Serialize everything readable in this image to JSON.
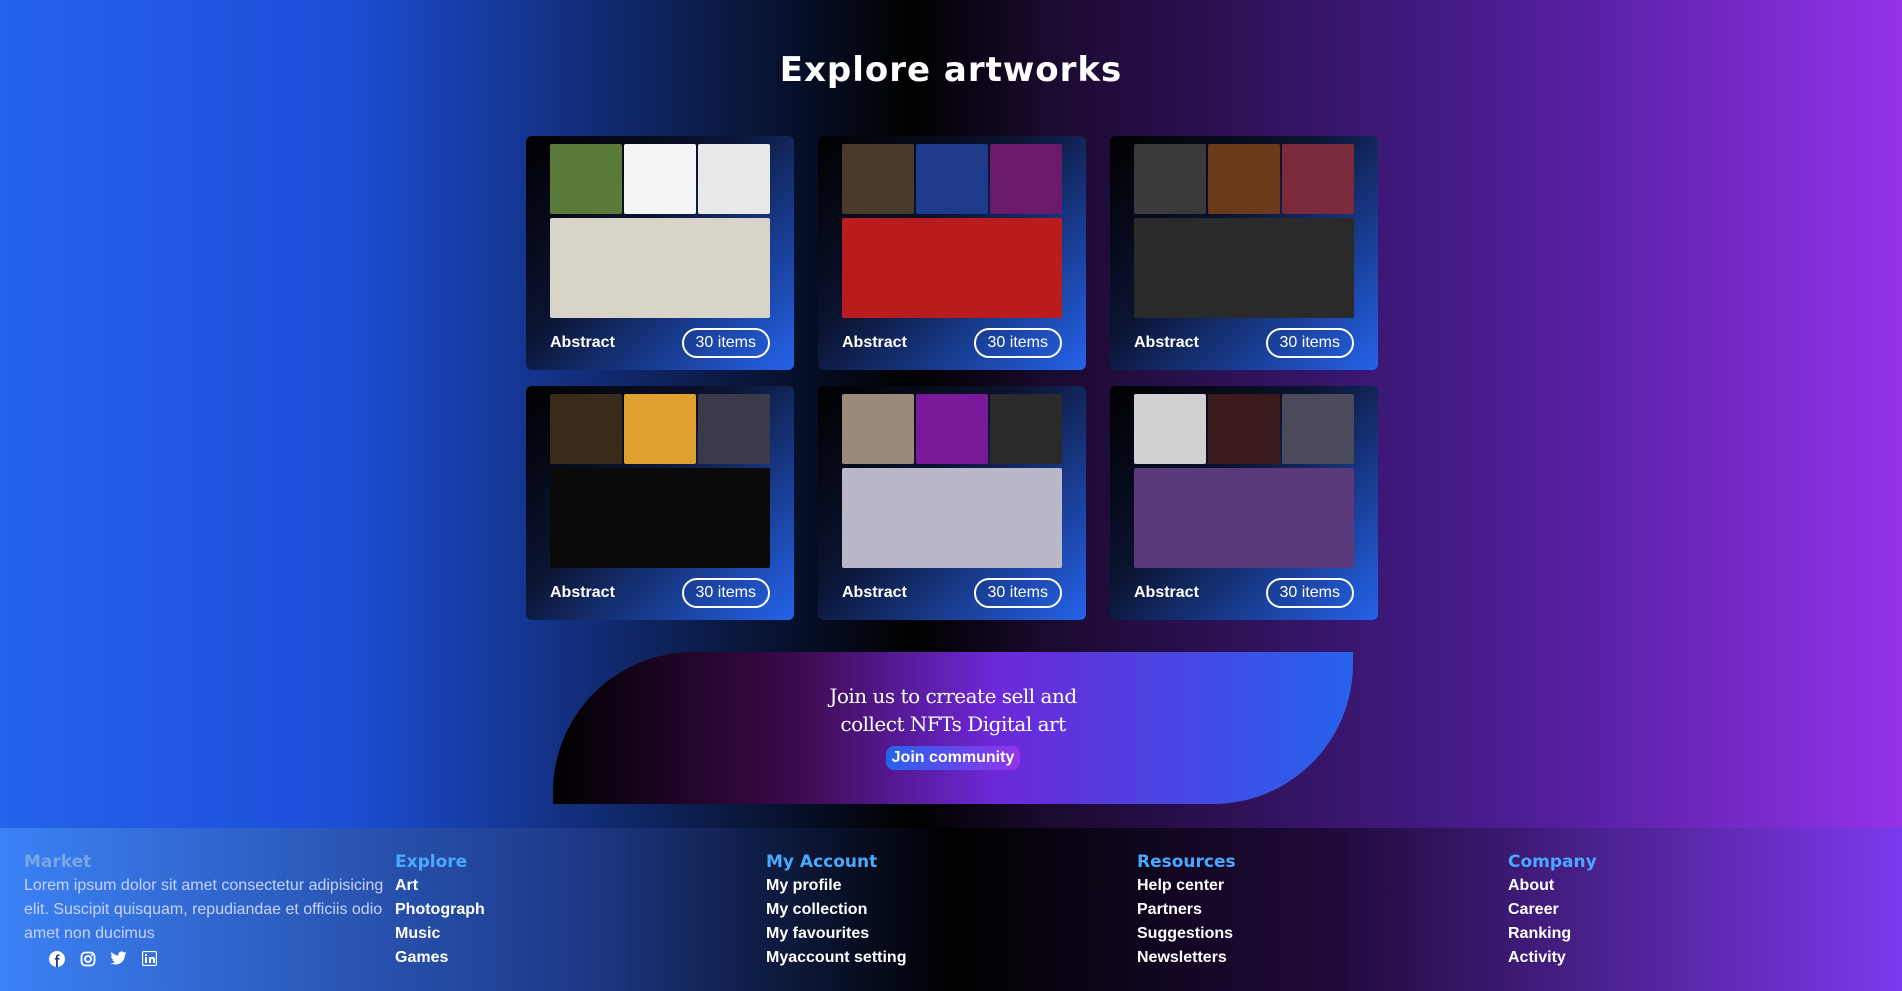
{
  "page": {
    "title": "Explore artworks"
  },
  "cards": [
    {
      "name": "Abstract",
      "count": "30 items",
      "thumbs": [
        "#5a7a3a",
        "#f5f5f5",
        "#e8e8e8"
      ],
      "main": "#d9d4c8"
    },
    {
      "name": "Abstract",
      "count": "30 items",
      "thumbs": [
        "#4a3a2a",
        "#1e3a8a",
        "#6b1a6b"
      ],
      "main": "#b91c1c"
    },
    {
      "name": "Abstract",
      "count": "30 items",
      "thumbs": [
        "#3a3a3a",
        "#6b3a1a",
        "#7a2a3a"
      ],
      "main": "#2a2a2a"
    },
    {
      "name": "Abstract",
      "count": "30 items",
      "thumbs": [
        "#3a2a1a",
        "#e0a030",
        "#3a3a4a"
      ],
      "main": "#0a0a0a"
    },
    {
      "name": "Abstract",
      "count": "30 items",
      "thumbs": [
        "#9a8a7a",
        "#7a1a9a",
        "#2a2a2a"
      ],
      "main": "#b8b8c8"
    },
    {
      "name": "Abstract",
      "count": "30 items",
      "thumbs": [
        "#d0d0d0",
        "#3a1a1a",
        "#4a4a5a"
      ],
      "main": "#5a3a7a"
    }
  ],
  "banner": {
    "line1": "Join us to crreate sell and",
    "line2": "collect NFTs Digital art",
    "button": "Join community"
  },
  "footer": {
    "market": {
      "heading": "Market",
      "description": "Lorem ipsum dolor sit amet consectetur adipisicing elit. Suscipit quisquam, repudiandae et officiis odio amet non ducimus"
    },
    "socials": [
      "facebook-icon",
      "instagram-icon",
      "twitter-icon",
      "linkedin-icon"
    ],
    "explore": {
      "heading": "Explore",
      "links": [
        "Art",
        "Photograph",
        "Music",
        "Games"
      ]
    },
    "account": {
      "heading": "My Account",
      "links": [
        "My profile",
        "My collection",
        "My favourites",
        "Myaccount setting"
      ]
    },
    "resources": {
      "heading": "Resources",
      "links": [
        "Help center",
        "Partners",
        "Suggestions",
        "Newsletters"
      ]
    },
    "company": {
      "heading": "Company",
      "links": [
        "About",
        "Career",
        "Ranking",
        "Activity"
      ]
    }
  }
}
